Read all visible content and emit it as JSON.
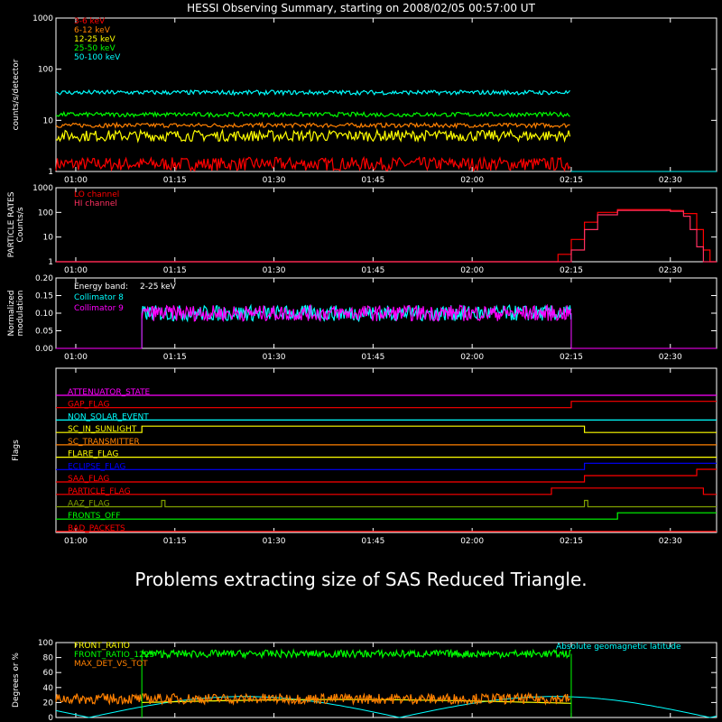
{
  "title": "HESSI Observing Summary, starting on 2008/02/05 00:57:00 UT",
  "message": "Problems extracting size of SAS Reduced Triangle.",
  "colors": {
    "white": "#ffffff",
    "red": "#ff0000",
    "orange": "#ff8000",
    "yellow": "#ffff00",
    "green": "#00ff00",
    "cyan": "#00ffff",
    "magenta": "#ff00ff",
    "blue": "#0000ff",
    "crimson": "#ff3060"
  },
  "time_axis": {
    "start": "00:57",
    "end": "02:37",
    "ticks": [
      "01:00",
      "01:15",
      "01:30",
      "01:45",
      "02:00",
      "02:15",
      "02:30"
    ]
  },
  "chart_data": [
    {
      "id": "count_rates",
      "type": "line",
      "ylabel": "counts/s/detector",
      "yscale": "log",
      "ylim": [
        1,
        1000
      ],
      "yticks": [
        "1",
        "10",
        "100",
        "1000"
      ],
      "series": [
        {
          "name": "3-6 keV",
          "color": "#ff0000",
          "level": 1.4,
          "ends": "02:15"
        },
        {
          "name": "6-12 keV",
          "color": "#ff8000",
          "level": 8,
          "ends": "02:15"
        },
        {
          "name": "12-25 keV",
          "color": "#ffff00",
          "level": 5,
          "ends": "02:15"
        },
        {
          "name": "25-50 keV",
          "color": "#00ff00",
          "level": 13,
          "ends": "02:15"
        },
        {
          "name": "50-100 keV",
          "color": "#00ffff",
          "level": 35,
          "ends": "02:15"
        }
      ]
    },
    {
      "id": "particle_rates",
      "type": "line",
      "ylabel": "PARTICLE RATES Counts/s",
      "yscale": "log",
      "ylim": [
        1,
        1000
      ],
      "yticks": [
        "1",
        "10",
        "100",
        "1000"
      ],
      "series": [
        {
          "name": "LO channel",
          "color": "#ff0000",
          "x": [
            "02:11",
            "02:13",
            "02:15",
            "02:17",
            "02:19",
            "02:22",
            "02:26",
            "02:30",
            "02:32",
            "02:34",
            "02:35",
            "02:36"
          ],
          "y": [
            1,
            2,
            8,
            40,
            100,
            130,
            130,
            120,
            90,
            20,
            3,
            1
          ]
        },
        {
          "name": "HI channel",
          "color": "#ff3060",
          "x": [
            "02:13",
            "02:15",
            "02:17",
            "02:19",
            "02:22",
            "02:26",
            "02:30",
            "02:32",
            "02:33",
            "02:34",
            "02:35"
          ],
          "y": [
            1,
            3,
            20,
            80,
            120,
            120,
            110,
            70,
            20,
            4,
            1
          ]
        }
      ]
    },
    {
      "id": "modulation",
      "type": "line",
      "ylabel": "Normalized modulation",
      "ylim": [
        0,
        0.2
      ],
      "yticks": [
        "0.00",
        "0.05",
        "0.10",
        "0.15",
        "0.20"
      ],
      "energy_band_label": "Energy band:",
      "energy_band": "2-25 keV",
      "series": [
        {
          "name": "Collimator 8",
          "color": "#00ffff",
          "level": 0.1,
          "starts": "01:10",
          "ends": "02:15"
        },
        {
          "name": "Collimator 9",
          "color": "#ff00ff",
          "level": 0.1,
          "starts": "01:10",
          "ends": "02:15"
        }
      ]
    }
  ],
  "flags": {
    "ylabel": "Flags",
    "items": [
      {
        "name": "ATTENUATOR_STATE",
        "color": "#ff00ff",
        "changes": []
      },
      {
        "name": "GAP_FLAG",
        "color": "#ff0000",
        "changes": [
          [
            "02:15",
            1
          ]
        ]
      },
      {
        "name": "NON_SOLAR_EVENT",
        "color": "#00ffff",
        "changes": []
      },
      {
        "name": "SC_IN_SUNLIGHT",
        "color": "#ffff00",
        "changes": [
          [
            "01:10",
            1
          ],
          [
            "02:17",
            0
          ]
        ]
      },
      {
        "name": "SC_TRANSMITTER",
        "color": "#ff8000",
        "changes": []
      },
      {
        "name": "FLARE_FLAG",
        "color": "#ffff00",
        "changes": []
      },
      {
        "name": "ECLIPSE_FLAG",
        "color": "#0000ff",
        "changes": [
          [
            "01:10",
            0
          ],
          [
            "02:17",
            1
          ]
        ]
      },
      {
        "name": "SAA_FLAG",
        "color": "#ff0000",
        "changes": [
          [
            "02:17",
            1
          ],
          [
            "02:34",
            2
          ]
        ]
      },
      {
        "name": "PARTICLE_FLAG",
        "color": "#ff0000",
        "changes": [
          [
            "02:12",
            1
          ],
          [
            "02:35",
            0
          ]
        ]
      },
      {
        "name": "AAZ_FLAG",
        "color": "#80a000",
        "changes": [
          [
            "01:13",
            1
          ],
          [
            "01:13.5",
            0
          ],
          [
            "02:17",
            1
          ],
          [
            "02:17.5",
            0
          ]
        ]
      },
      {
        "name": "FRONTS_OFF",
        "color": "#00ff00",
        "changes": [
          [
            "01:10",
            0
          ],
          [
            "02:22",
            1
          ]
        ]
      },
      {
        "name": "BAD_PACKETS",
        "color": "#ff0000",
        "changes": []
      }
    ]
  },
  "geo": {
    "ylabel": "Degrees or %",
    "ylim": [
      0,
      100
    ],
    "yticks": [
      "0",
      "20",
      "40",
      "60",
      "80",
      "100"
    ],
    "series": [
      {
        "name": "FRONT_RATIO",
        "color": "#ffff00",
        "level": 20
      },
      {
        "name": "FRONT_RATIO_1225",
        "color": "#00ff00",
        "level": 85
      },
      {
        "name": "MAX_DET_VS_TOT",
        "color": "#ff8000",
        "level": 25
      },
      {
        "name": "Absolute geomagnetic latitude",
        "color": "#00ffff"
      }
    ]
  }
}
